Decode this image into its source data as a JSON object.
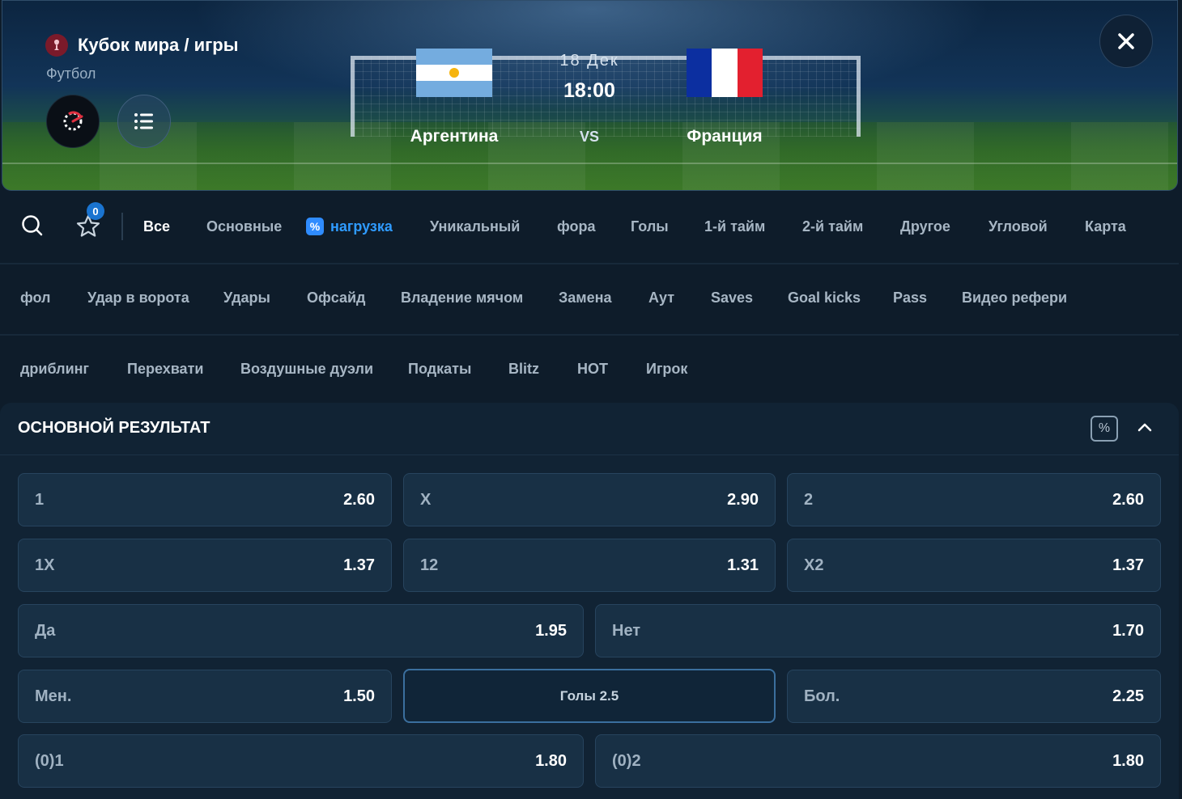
{
  "header": {
    "competition": "Кубок мира / игры",
    "sport": "Футбол",
    "date": "18 Дек",
    "time": "18:00",
    "vs": "VS",
    "home_team": "Аргентина",
    "away_team": "Франция",
    "icons": {
      "competition": "trophy-icon",
      "stats": "live-stats-icon",
      "list": "list-icon",
      "close": "close-icon"
    }
  },
  "tabs_row1": {
    "search_icon": "search-icon",
    "favorites_icon": "star-icon",
    "favorites_count": "0",
    "items": [
      "Все",
      "Основные",
      "нагрузка",
      "Уникальный",
      "фора",
      "Голы",
      "1-й тайм",
      "2-й тайм",
      "Другое",
      "Угловой",
      "Карта"
    ],
    "active": "Все",
    "load_badge": "%"
  },
  "tabs_row2": {
    "items": [
      "фол",
      "Удар в ворота",
      "Удары",
      "Офсайд",
      "Владение мячом",
      "Замена",
      "Аут",
      "Saves",
      "Goal kicks",
      "Pass",
      "Видео рефери"
    ]
  },
  "tabs_row3": {
    "items": [
      "дриблинг",
      "Перехвати",
      "Воздушные дуэли",
      "Подкаты",
      "Blitz",
      "HOT",
      "Игрок"
    ]
  },
  "market": {
    "title": "ОСНОВНОЙ РЕЗУЛЬТАТ",
    "margin_badge": "%",
    "collapse_icon": "chevron-up-icon",
    "odds": [
      {
        "label": "1",
        "value": "2.60"
      },
      {
        "label": "X",
        "value": "2.90"
      },
      {
        "label": "2",
        "value": "2.60"
      },
      {
        "label": "1X",
        "value": "1.37"
      },
      {
        "label": "12",
        "value": "1.31"
      },
      {
        "label": "X2",
        "value": "1.37"
      },
      {
        "label": "Да",
        "value": "1.95"
      },
      {
        "label": "Нет",
        "value": "1.70"
      },
      {
        "label": "Мен.",
        "value": "1.50"
      },
      {
        "label": "Голы 2.5",
        "value": ""
      },
      {
        "label": "Бол.",
        "value": "2.25"
      },
      {
        "label": "(0)1",
        "value": "1.80"
      },
      {
        "label": "(0)2",
        "value": "1.80"
      }
    ]
  },
  "colors": {
    "background": "#0e1c2a",
    "accent_blue": "#2f9bff",
    "odd_button": "#183045",
    "argentina_blue": "#74acdf",
    "france_blue": "#0c2fa0",
    "france_red": "#e3202f"
  }
}
